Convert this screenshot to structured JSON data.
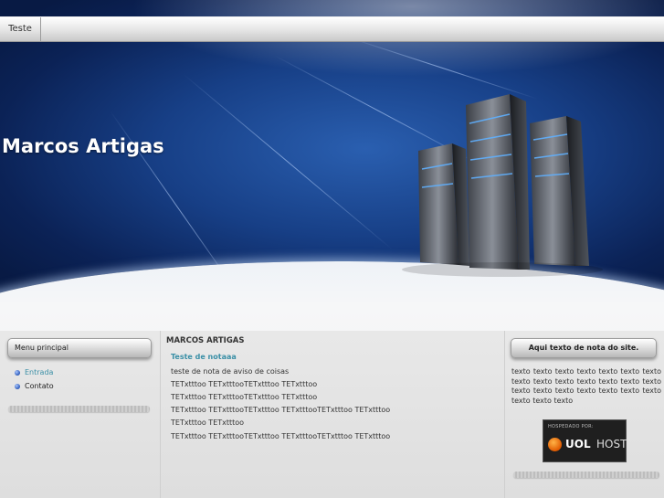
{
  "nav": {
    "items": [
      {
        "label": "Teste"
      }
    ]
  },
  "header": {
    "site_title": "Marcos Artigas"
  },
  "sidebar": {
    "title": "Menu principal",
    "items": [
      {
        "label": "Entrada",
        "active": true
      },
      {
        "label": "Contato",
        "active": false
      }
    ]
  },
  "main": {
    "heading": "MARCOS ARTIGAS",
    "post_title": "Teste de notaaa",
    "lines": [
      "teste de nota de aviso de coisas",
      "TETxtttoo TETxtttooTETxtttoo TETxtttoo",
      "TETxtttoo TETxtttooTETxtttoo TETxtttoo",
      "TETxtttoo TETxtttooTETxtttoo TETxtttooTETxtttoo TETxtttoo",
      "TETxtttoo TETxtttoo",
      "TETxtttoo TETxtttooTETxtttoo TETxtttooTETxtttoo TETxtttoo"
    ]
  },
  "right": {
    "title": "Aqui texto de nota do site.",
    "text": "texto texto texto texto texto texto texto texto texto texto texto texto texto texto texto texto texto texto texto texto texto texto texto texto",
    "badge": {
      "top": "HOSPEDADO POR:",
      "brand": "UOL",
      "suffix": "HOST"
    }
  },
  "colors": {
    "link": "#3a8fa6",
    "header_blue": "#173f86"
  }
}
